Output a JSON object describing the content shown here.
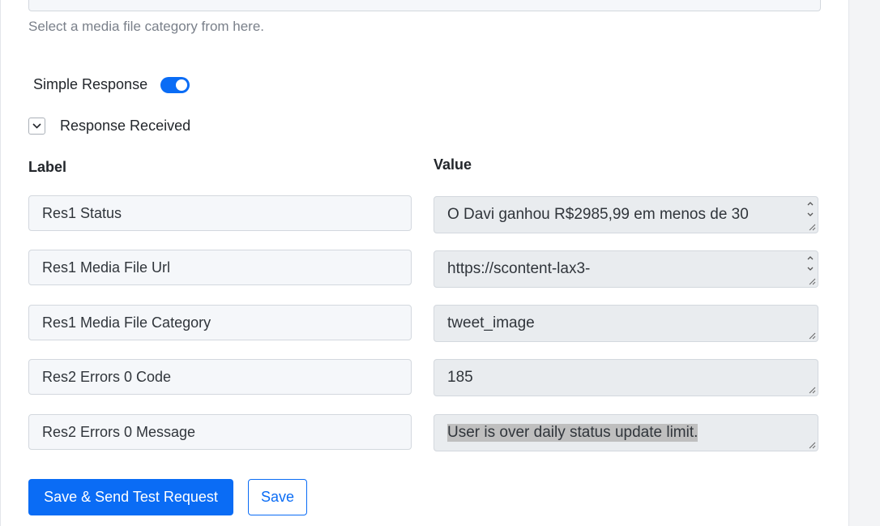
{
  "media_category": {
    "hint": "Select a media file category from here."
  },
  "simple_response": {
    "label": "Simple Response",
    "enabled": true
  },
  "response_received": {
    "label": "Response Received",
    "expanded": true
  },
  "table": {
    "label_header": "Label",
    "value_header": "Value",
    "rows": [
      {
        "label": "Res1 Status",
        "value": "O Davi ganhou R$2985,99 em menos de 30"
      },
      {
        "label": "Res1 Media File Url",
        "value": "https://scontent-lax3-"
      },
      {
        "label": "Res1 Media File Category",
        "value": "tweet_image"
      },
      {
        "label": "Res2 Errors 0 Code",
        "value": "185"
      },
      {
        "label": "Res2 Errors 0 Message",
        "value": "User is over daily status update limit."
      }
    ]
  },
  "buttons": {
    "save_send": "Save & Send Test Request",
    "save": "Save"
  },
  "colors": {
    "accent": "#0a6cf5",
    "label_bg": "#f5f7fa",
    "value_bg": "#e9ecef",
    "selection": "#bfbfbf"
  },
  "icons": {
    "collapse": "chevron-down-icon",
    "resize": "resize-handle-icon",
    "spinner": "scroll-arrows-icon"
  }
}
